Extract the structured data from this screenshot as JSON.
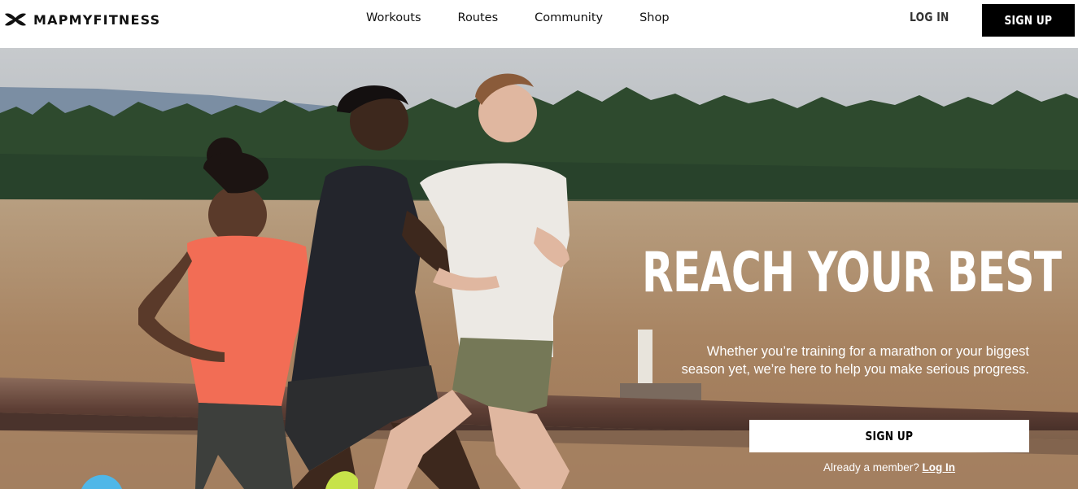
{
  "brand": {
    "name": "MAPMYFITNESS",
    "logo_icon": "under-armour-logo-icon"
  },
  "nav": {
    "items": [
      "Workouts",
      "Routes",
      "Community",
      "Shop"
    ]
  },
  "header": {
    "login_label": "LOG IN",
    "signup_label": "SIGN UP"
  },
  "hero": {
    "title": "REACH YOUR BEST",
    "subtitle_line1": "Whether you’re training for a marathon or your biggest",
    "subtitle_line2": "season yet, we’re here to help you make serious progress.",
    "cta_label": "SIGN UP",
    "member_text": "Already a member?",
    "member_link": "Log In"
  },
  "colors": {
    "accent": "#000000",
    "background": "#ffffff",
    "hero_text": "#ffffff"
  }
}
